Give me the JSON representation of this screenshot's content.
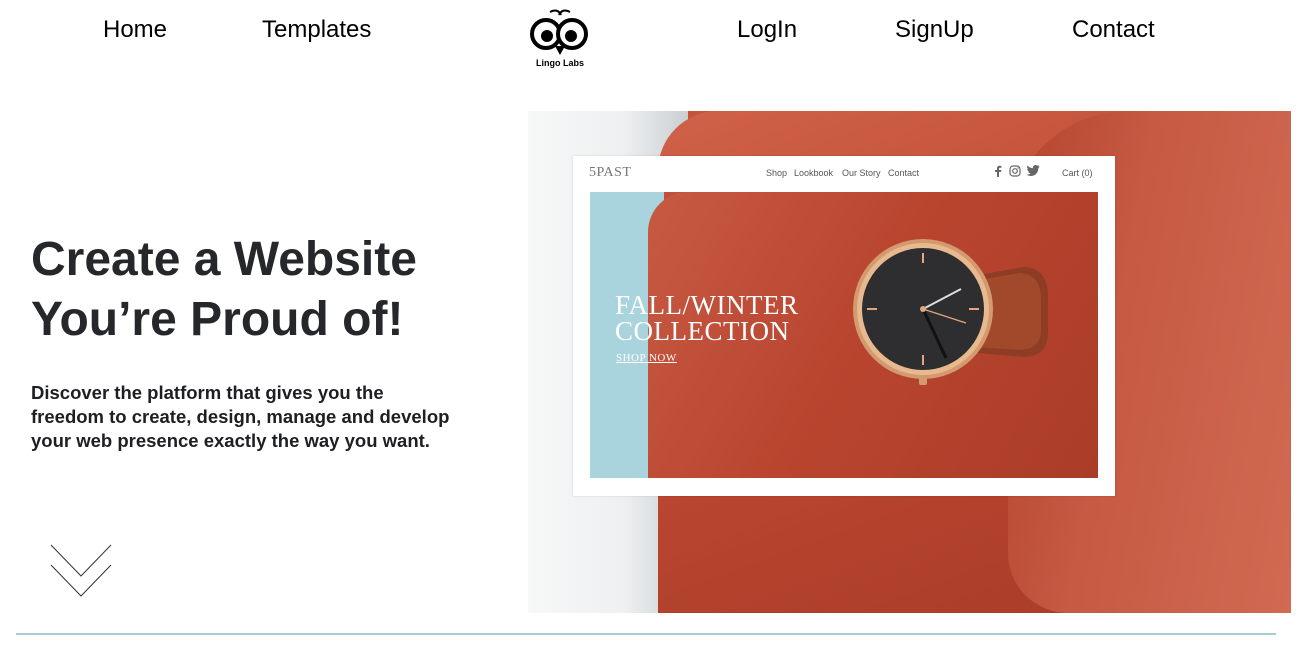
{
  "nav": {
    "items": [
      {
        "label": "Home"
      },
      {
        "label": "Templates"
      },
      {
        "label": "LogIn"
      },
      {
        "label": "SignUp"
      },
      {
        "label": "Contact"
      }
    ],
    "logo_text": "Lingo Labs"
  },
  "hero": {
    "title_line1": "Create a Website",
    "title_line2": "You’re Proud of!",
    "description": "Discover the platform that gives you the freedom to create, design, manage and develop your web presence exactly the way you want."
  },
  "showcase": {
    "brand": "5PAST",
    "nav": [
      "Shop",
      "Lookbook",
      "Our Story",
      "Contact"
    ],
    "cart": "Cart (0)",
    "headline_line1": "FALL/WINTER",
    "headline_line2": "COLLECTION",
    "cta": "SHOP NOW"
  },
  "colors": {
    "heading": "#25272a",
    "accent_line": "#a8ccd3",
    "sleeve": "#c5533c",
    "mock_blue": "#a9d4dd"
  }
}
